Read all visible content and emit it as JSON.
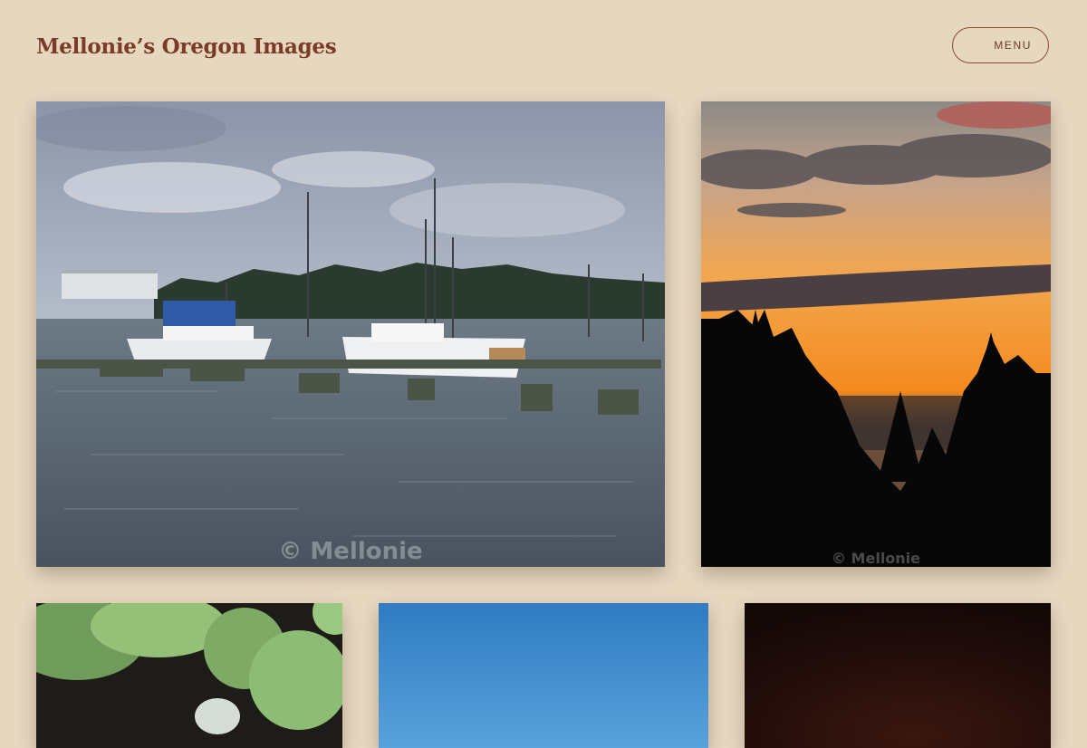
{
  "site": {
    "title": "Mellonie’s Oregon Images",
    "menu_label": "MENU"
  },
  "gallery": {
    "photos": [
      {
        "subject": "harbor-marina",
        "watermark": "© Mellonie"
      },
      {
        "subject": "sunset-over-trees",
        "watermark": "© Mellonie"
      },
      {
        "subject": "lily-pads"
      },
      {
        "subject": "blue-sky"
      },
      {
        "subject": "dark-night"
      }
    ]
  },
  "colors": {
    "background": "#e6d8bf",
    "title": "#7b3b26",
    "menu_border": "#8a4a32"
  }
}
